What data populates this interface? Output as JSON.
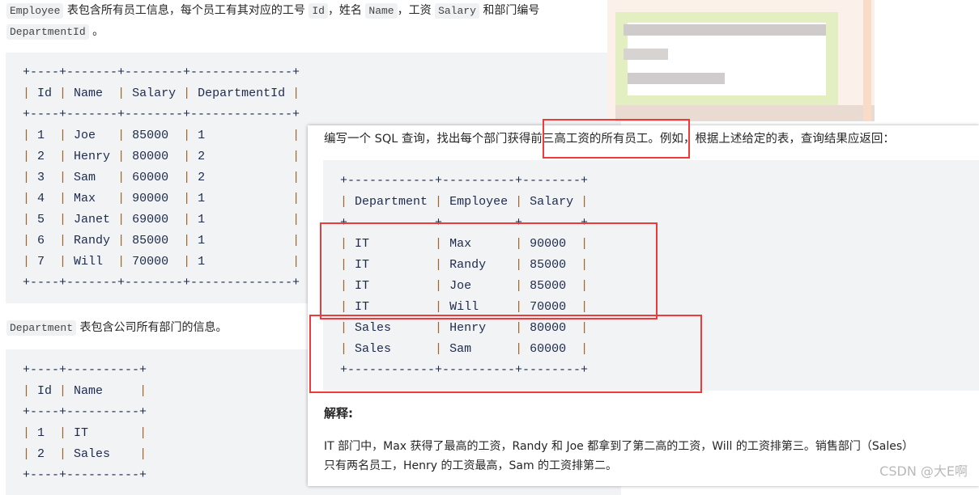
{
  "intro": {
    "code1": "Employee",
    "t1": " 表包含所有员工信息，每个员工有其对应的工号 ",
    "code2": "Id",
    "t2": "，姓名 ",
    "code3": "Name",
    "t3": "，工资 ",
    "code4": "Salary",
    "t4": " 和部门编号",
    "code5": "DepartmentId",
    "t5": " 。"
  },
  "employee_table": [
    "+----+-------+--------+--------------+",
    "| Id | Name  | Salary | DepartmentId |",
    "+----+-------+--------+--------------+",
    "| 1  | Joe   | 85000  | 1            |",
    "| 2  | Henry | 80000  | 2            |",
    "| 3  | Sam   | 60000  | 2            |",
    "| 4  | Max   | 90000  | 1            |",
    "| 5  | Janet | 69000  | 1            |",
    "| 6  | Randy | 85000  | 1            |",
    "| 7  | Will  | 70000  | 1            |",
    "+----+-------+--------+--------------+"
  ],
  "dept_intro": {
    "code": "Department",
    "text": " 表包含公司所有部门的信息。"
  },
  "department_table": [
    "+----+----------+",
    "| Id | Name     |",
    "+----+----------+",
    "| 1  | IT       |",
    "| 2  | Sales    |",
    "+----+----------+"
  ],
  "panel": {
    "question": "编写一个 SQL 查询，找出每个部门获得前三高工资的所有员工。例如，根据上述给定的表，查询结果应返回：",
    "result_table": [
      "+------------+----------+--------+",
      "| Department | Employee | Salary |",
      "+            +          +        +",
      "| IT         | Max      | 90000  |",
      "| IT         | Randy    | 85000  |",
      "| IT         | Joe      | 85000  |",
      "| IT         | Will     | 70000  |",
      "| Sales      | Henry    | 80000  |",
      "| Sales      | Sam      | 60000  |",
      "+------------+----------+--------+"
    ],
    "explain_title": "解释:",
    "explain_1": "IT 部门中，Max 获得了最高的工资，Randy 和 Joe 都拿到了第二高的工资，Will 的工资排第三。销售部门（Sales）",
    "explain_2": "只有两名员工，Henry 的工资最高，Sam 的工资排第二。",
    "watermark": "CSDN @大E啊"
  },
  "colors": {
    "highlight": "#f03a3a",
    "code_bg": "#f2f3f5",
    "pipe": "#a0652a"
  }
}
